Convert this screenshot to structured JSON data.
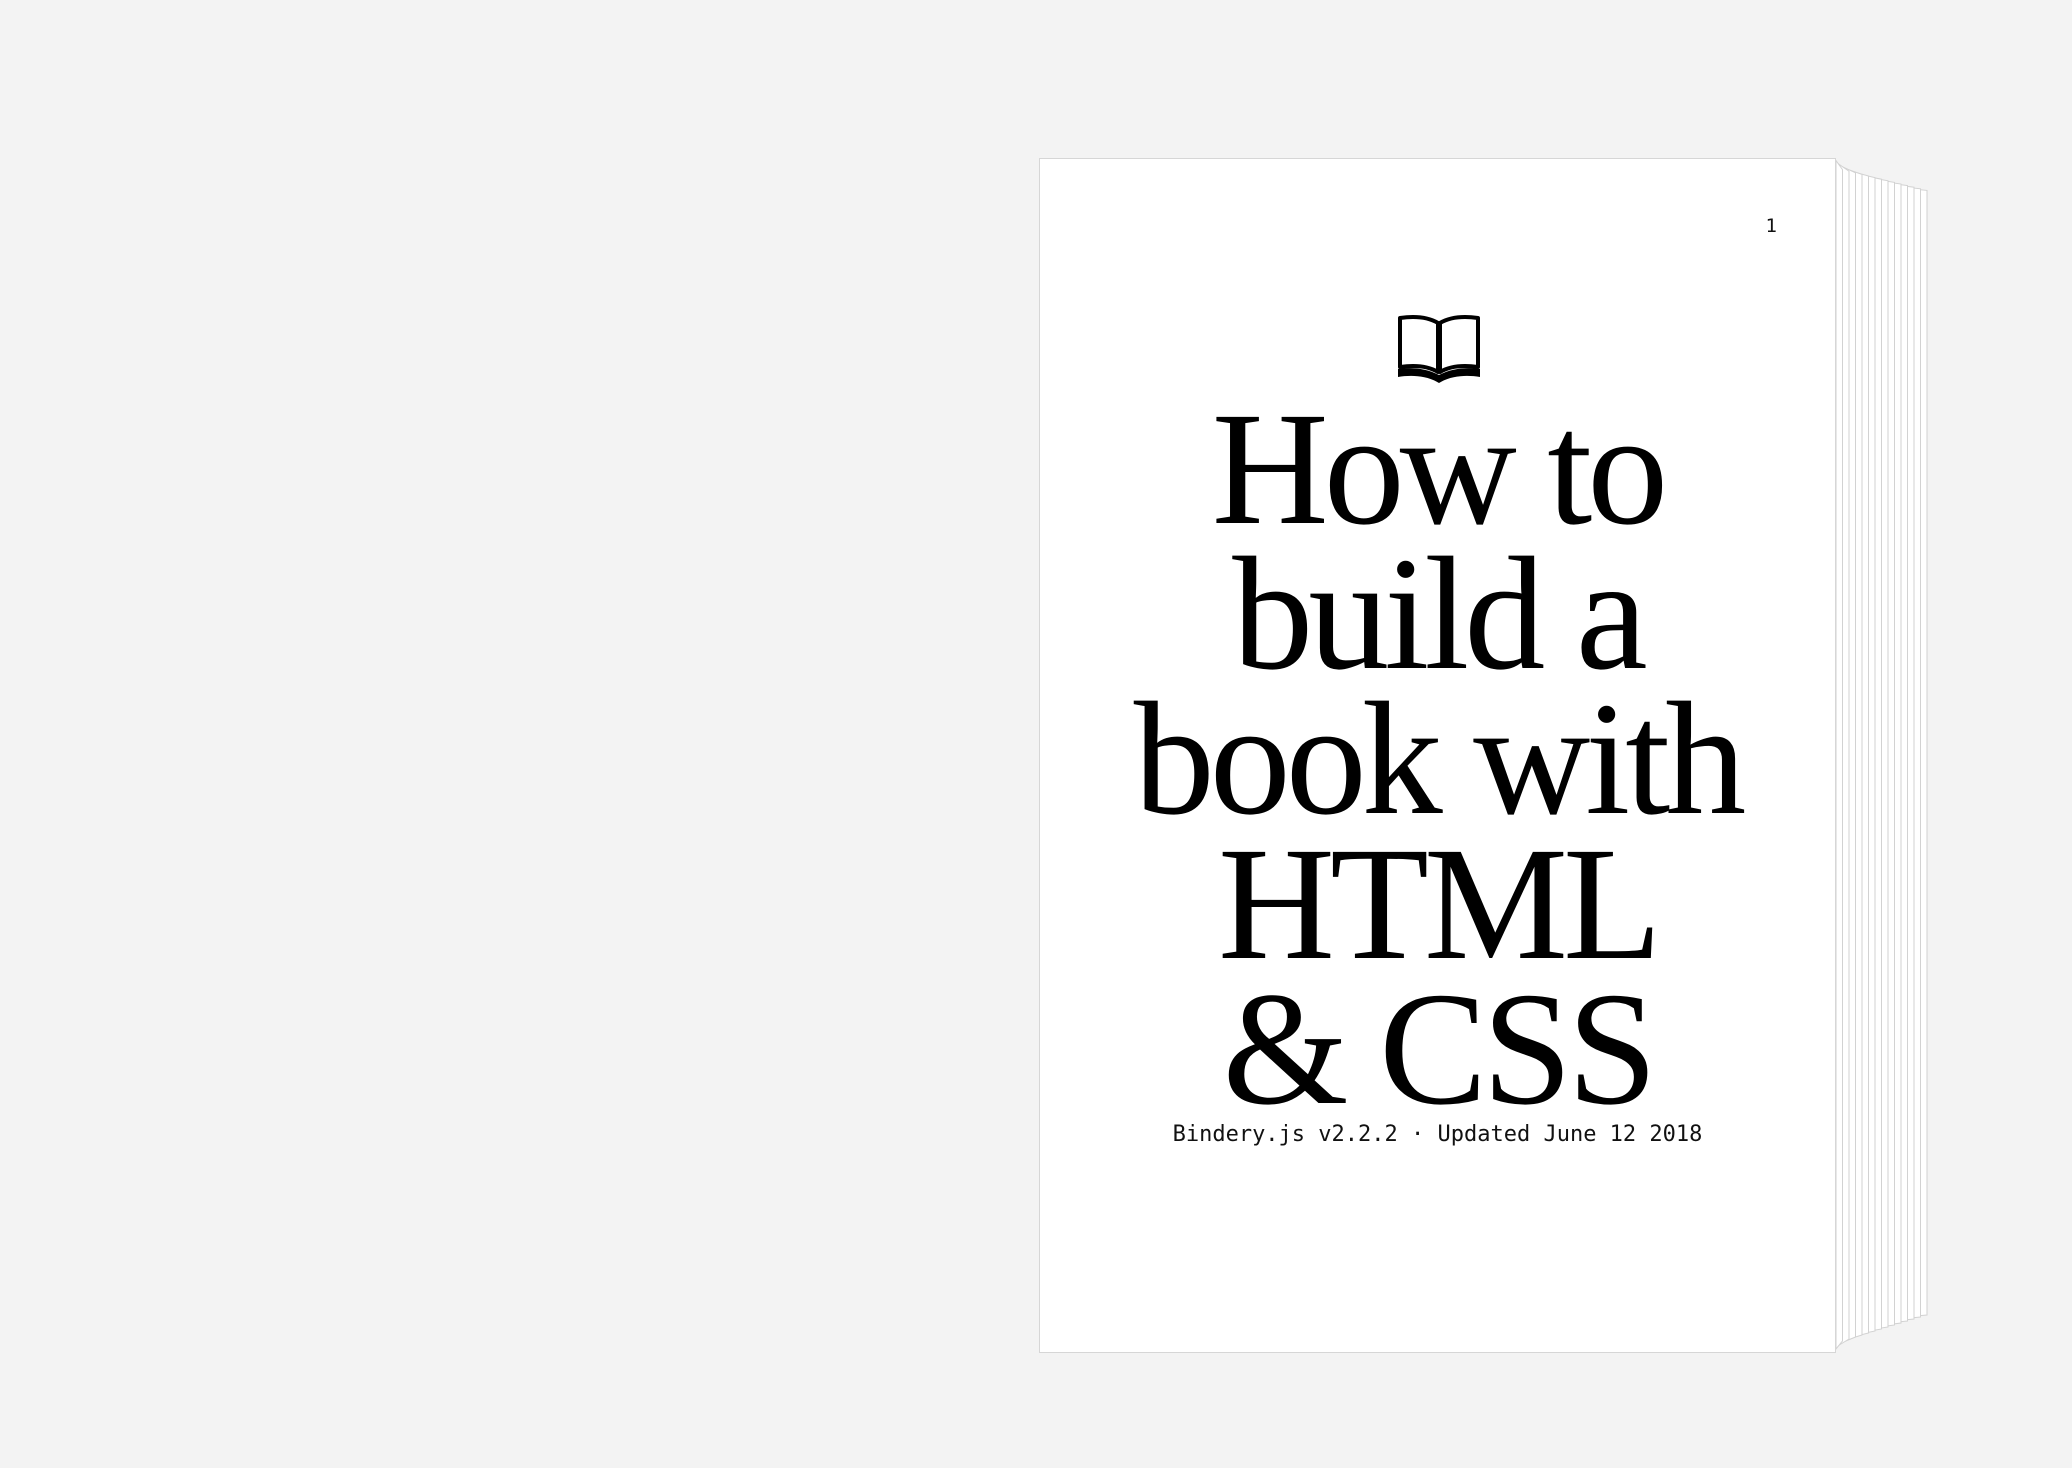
{
  "background_color": "#f3f3f3",
  "page_color": "#ffffff",
  "cover": {
    "page_number": "1",
    "icon": "open-book-icon",
    "title_lines": [
      "How to",
      "build a",
      "book with",
      "HTML",
      "& CSS"
    ],
    "subtitle": "Bindery.js v2.2.2 · Updated June 12 2018"
  }
}
